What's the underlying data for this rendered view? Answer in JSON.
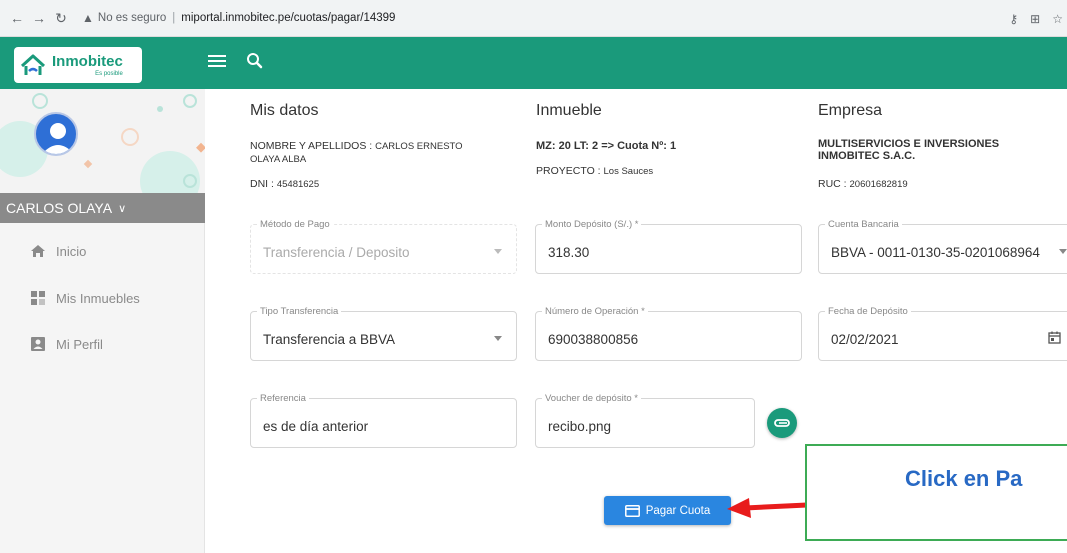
{
  "browser": {
    "security": "No es seguro",
    "url": "miportal.inmobitec.pe/cuotas/pagar/14399"
  },
  "brand": {
    "name": "Inmobitec",
    "tagline": "Es posible",
    "primary_color": "#1a9a7b"
  },
  "sidebar": {
    "user_name": "CARLOS OLAYA",
    "items": [
      {
        "label": "Inicio",
        "icon": "home-icon"
      },
      {
        "label": "Mis Inmuebles",
        "icon": "grid-icon"
      },
      {
        "label": "Mi Perfil",
        "icon": "profile-card-icon"
      }
    ]
  },
  "mis_datos": {
    "title": "Mis datos",
    "name_label": "NOMBRE Y APELLIDOS :",
    "name_value_1": "CARLOS ERNESTO",
    "name_value_2": "OLAYA ALBA",
    "dni_label": "DNI :",
    "dni_value": "45481625"
  },
  "inmueble": {
    "title": "Inmueble",
    "lote": "MZ: 20 LT: 2 => Cuota Nº: 1",
    "proyecto_label": "PROYECTO :",
    "proyecto_value": "Los Sauces"
  },
  "empresa": {
    "title": "Empresa",
    "name_1": "MULTISERVICIOS E INVERSIONES",
    "name_2": "INMOBITEC S.A.C.",
    "ruc_label": "RUC :",
    "ruc_value": "20601682819"
  },
  "form": {
    "metodo_pago": {
      "label": "Método de Pago",
      "value": "Transferencia / Deposito"
    },
    "monto": {
      "label": "Monto Depósito (S/.) *",
      "value": "318.30"
    },
    "cuenta": {
      "label": "Cuenta Bancaria",
      "value": "BBVA - 0011-0130-35-0201068964"
    },
    "tipo_transferencia": {
      "label": "Tipo Transferencia",
      "value": "Transferencia a BBVA"
    },
    "numero_operacion": {
      "label": "Número de Operación *",
      "value": "690038800856"
    },
    "fecha_deposito": {
      "label": "Fecha de Depósito",
      "value": "02/02/2021"
    },
    "referencia": {
      "label": "Referencia",
      "value": "es de día anterior"
    },
    "voucher": {
      "label": "Voucher de depósito *",
      "value": "recibo.png"
    }
  },
  "pay_button": {
    "label": "Pagar Cuota",
    "color": "#2a86e0"
  },
  "callout": {
    "text": "Click en Pa"
  }
}
